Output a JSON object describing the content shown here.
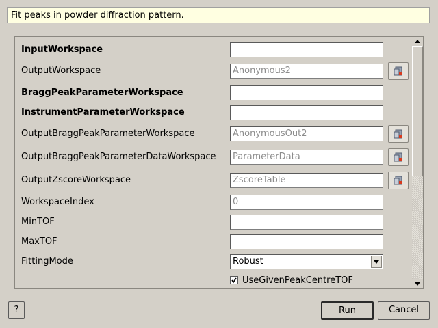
{
  "description": "Fit peaks in powder diffraction pattern.",
  "properties": [
    {
      "label": "InputWorkspace",
      "value": ""
    },
    {
      "label": "OutputWorkspace",
      "value": "Anonymous2"
    },
    {
      "label": "BraggPeakParameterWorkspace",
      "value": ""
    },
    {
      "label": "InstrumentParameterWorkspace",
      "value": ""
    },
    {
      "label": "OutputBraggPeakParameterWorkspace",
      "value": "AnonymousOut2"
    },
    {
      "label": "OutputBraggPeakParameterDataWorkspace",
      "value": "ParameterData"
    },
    {
      "label": "OutputZscoreWorkspace",
      "value": "ZscoreTable"
    },
    {
      "label": "WorkspaceIndex",
      "value": "0"
    },
    {
      "label": "MinTOF",
      "value": ""
    },
    {
      "label": "MaxTOF",
      "value": ""
    },
    {
      "label": "FittingMode",
      "value": "Robust"
    }
  ],
  "use_given_peak_centre": {
    "label": "UseGivenPeakCentreTOF",
    "checked": true
  },
  "buttons": {
    "help": "?",
    "run": "Run",
    "cancel": "Cancel"
  },
  "icons": {
    "history": "workspace-history-icon",
    "check": "check-icon"
  }
}
